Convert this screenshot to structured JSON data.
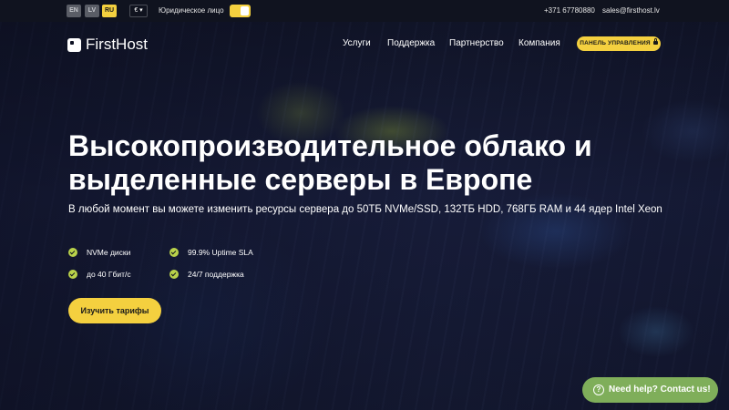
{
  "topbar": {
    "languages": [
      "EN",
      "LV",
      "RU"
    ],
    "active_language": "RU",
    "currency": "€ ▾",
    "legal_entity_label": "Юридическое лицо",
    "phone": "+371 67780880",
    "email": "sales@firsthost.lv"
  },
  "header": {
    "logo_text": "FirstHost",
    "nav": [
      "Услуги",
      "Поддержка",
      "Партнерство",
      "Компания"
    ],
    "panel_button": "ПАНЕЛЬ УПРАВЛЕНИЯ"
  },
  "hero": {
    "title": "Высокопроизводительное облако и выделенные серверы в Европе",
    "subtitle": "В любой момент вы можете изменить ресурсы сервера до 50ТБ NVMe/SSD, 132ТБ HDD, 768ГБ RAM и 44 ядер Intel Xeon",
    "features": [
      "NVMe диски",
      "99.9% Uptime SLA",
      "до 40 Гбит/с",
      "24/7 поддержка"
    ],
    "cta": "Изучить тарифы"
  },
  "help_widget": {
    "label": "Need help? Contact us!",
    "icon": "?"
  },
  "colors": {
    "accent": "#f4d03f",
    "check": "#b9d24a",
    "help": "#7fae5a"
  }
}
